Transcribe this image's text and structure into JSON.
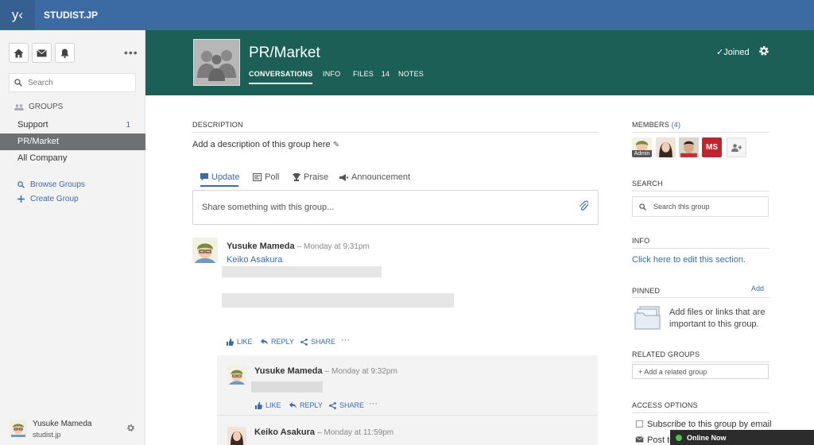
{
  "topbar": {
    "logo": "y‹",
    "network": "STUDIST.JP"
  },
  "sidebar": {
    "search_placeholder": "Search",
    "groups_heading": "GROUPS",
    "groups": [
      {
        "label": "Support",
        "count": "1"
      },
      {
        "label": "PR/Market",
        "count": ""
      },
      {
        "label": "All Company",
        "count": ""
      }
    ],
    "browse": "Browse Groups",
    "create": "Create Group",
    "user_name": "Yusuke Mameda",
    "user_network": "studist.jp"
  },
  "group": {
    "title": "PR/Market",
    "tabs": [
      "CONVERSATIONS",
      "INFO",
      "FILES",
      "NOTES"
    ],
    "files_count": "14",
    "joined": "Joined"
  },
  "main": {
    "description_label": "DESCRIPTION",
    "description_text": "Add a description of this group here",
    "composer_tabs": [
      "Update",
      "Poll",
      "Praise",
      "Announcement"
    ],
    "composer_placeholder": "Share something with this group...",
    "post": {
      "author": "Yusuke Mameda",
      "time": "– Monday at 9:31pm",
      "mention": "Keiko Asakura"
    },
    "actions": {
      "like": "LIKE",
      "reply": "REPLY",
      "share": "SHARE",
      "more": "···"
    },
    "reply1": {
      "author": "Yusuke Mameda",
      "time": "– Monday at 9:32pm"
    },
    "reply2": {
      "author": "Keiko Asakura",
      "time": "– Monday at 11:59pm"
    }
  },
  "right": {
    "members_label": "MEMBERS",
    "members_count": "(4)",
    "admin_badge": "Admin",
    "ms_initials": "MS",
    "search_label": "SEARCH",
    "search_placeholder": "Search this group",
    "info_label": "INFO",
    "info_link": "Click here to edit this section.",
    "pinned_label": "PINNED",
    "pinned_add": "Add",
    "pinned_text": "Add files or links that are important to this group.",
    "related_label": "RELATED GROUPS",
    "related_placeholder": "+ Add a related group",
    "access_label": "ACCESS OPTIONS",
    "subscribe": "Subscribe to this group by email",
    "post_to": "Post to"
  },
  "chat": {
    "online": "Online Now"
  },
  "colors": {
    "topbar": "#3c6aa2",
    "banner": "#1b5f57",
    "link": "#3c6aa2",
    "ms_badge": "#c0252e"
  }
}
